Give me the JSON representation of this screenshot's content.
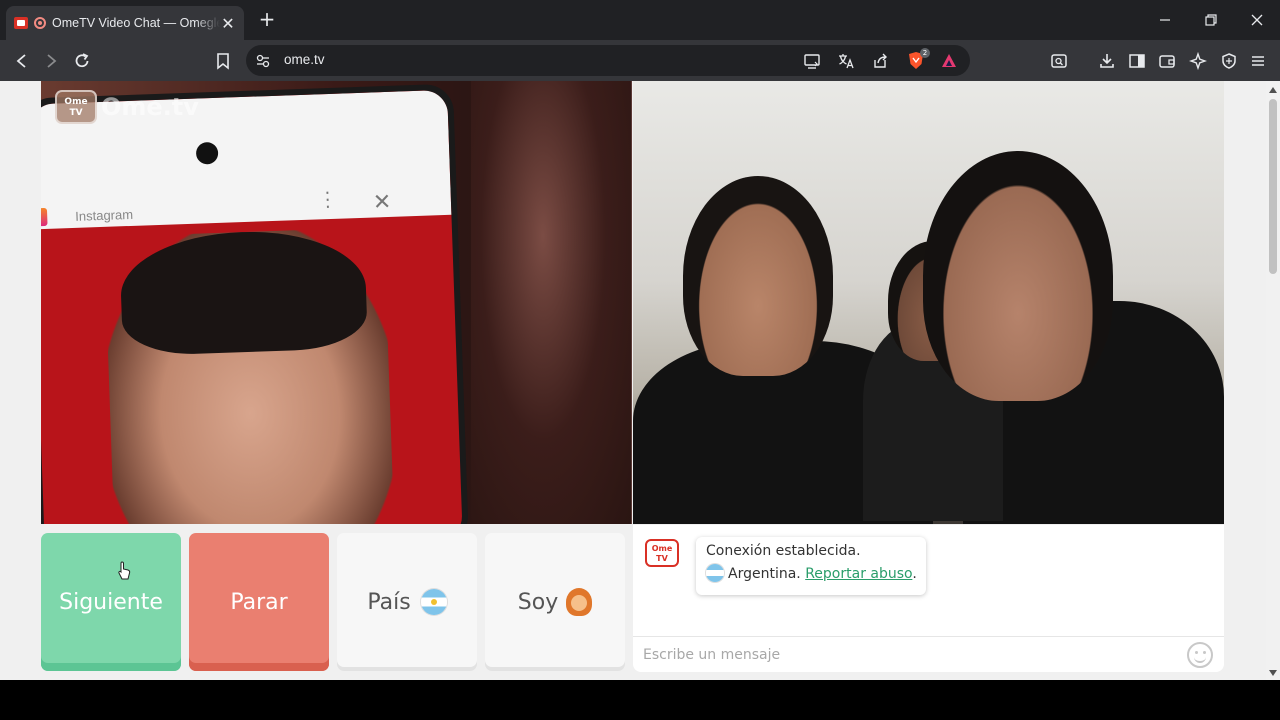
{
  "browser": {
    "tab_title": "OmeTV Video Chat — Omegle",
    "new_tab": "+",
    "close_tab": "✕",
    "url": "ome.tv",
    "shields_count": "2"
  },
  "video": {
    "logo_tv": "Ome TV",
    "logo_text": "Ome.tv",
    "phone_app_label": "Instagram"
  },
  "controls": {
    "next_label": "Siguiente",
    "stop_label": "Parar",
    "country_label": "País",
    "gender_label": "Soy"
  },
  "chat": {
    "logo_tv": "Ome TV",
    "status_text": "Conexión establecida.",
    "country_text": "Argentina.",
    "report_link": "Reportar abuso",
    "report_suffix": ".",
    "input_placeholder": "Escribe un mensaje"
  },
  "colors": {
    "next_button": "#7ed7ab",
    "stop_button": "#ea7f70",
    "link": "#2a9d6a"
  }
}
